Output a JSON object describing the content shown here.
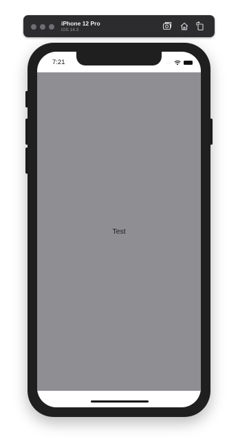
{
  "toolbar": {
    "device_name": "iPhone 12 Pro",
    "os_version": "iOS 14.3",
    "icons": [
      "screenshot-icon",
      "home-icon",
      "rotate-icon"
    ]
  },
  "status_bar": {
    "time": "7:21",
    "signal": "....",
    "icons": [
      "wifi-icon",
      "battery-icon"
    ]
  },
  "content": {
    "label": "Test"
  },
  "colors": {
    "toolbar_bg": "#2c2c2e",
    "device_frame": "#1f1f1f",
    "content_bg": "#8e8e93"
  }
}
